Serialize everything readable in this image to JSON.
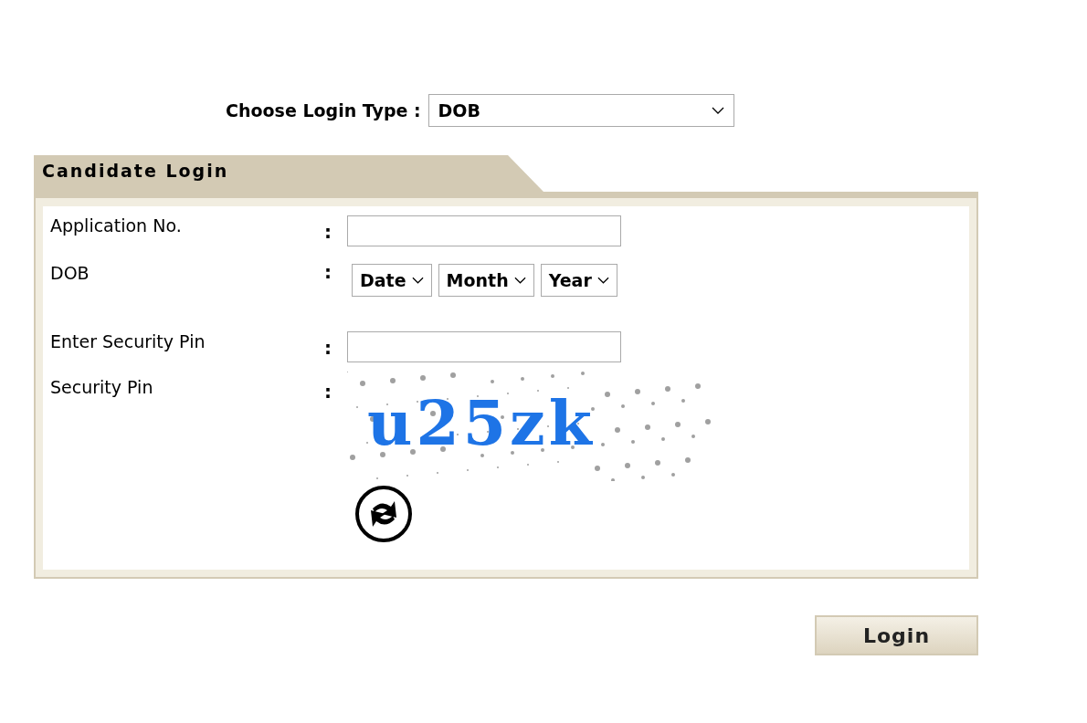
{
  "login_type": {
    "label": "Choose Login Type :",
    "value": "DOB"
  },
  "panel": {
    "title": "Candidate Login",
    "rows": [
      {
        "kind": "input",
        "label": "Application No.",
        "separator": ":"
      },
      {
        "kind": "selects",
        "label": "DOB",
        "separator": ":",
        "selects": [
          "Date",
          "Month",
          "Year"
        ]
      },
      {
        "kind": "input",
        "label": "Enter Security Pin",
        "separator": ":"
      },
      {
        "kind": "captcha",
        "label": "Security Pin",
        "separator": ":",
        "captcha_text": "u25zk"
      }
    ]
  },
  "login_button": "Login"
}
